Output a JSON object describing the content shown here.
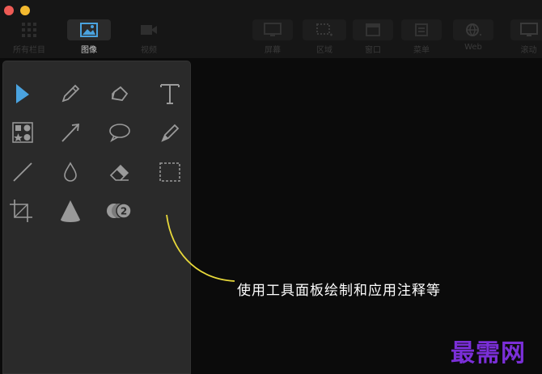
{
  "window": {
    "traffic_lights": [
      "close",
      "minimize"
    ]
  },
  "toolbar": {
    "items": [
      {
        "label": "所有栏目"
      },
      {
        "label": "图像"
      },
      {
        "label": "视频"
      },
      {
        "label": "屏幕"
      },
      {
        "label": "区域"
      },
      {
        "label": "窗口"
      },
      {
        "label": "菜单"
      },
      {
        "label": "Web"
      },
      {
        "label": "滚动"
      }
    ]
  },
  "tools_panel": {
    "tools": [
      {
        "icon": "arrow-cursor-icon"
      },
      {
        "icon": "pencil-icon"
      },
      {
        "icon": "highlighter-icon"
      },
      {
        "icon": "text-icon"
      },
      {
        "icon": "shapes-icon"
      },
      {
        "icon": "arrow-line-icon"
      },
      {
        "icon": "speech-bubble-icon"
      },
      {
        "icon": "marker-icon"
      },
      {
        "icon": "line-icon"
      },
      {
        "icon": "drop-icon"
      },
      {
        "icon": "eraser-icon"
      },
      {
        "icon": "selection-rect-icon"
      },
      {
        "icon": "crop-icon"
      },
      {
        "icon": "spotlight-icon"
      },
      {
        "icon": "counter-icon"
      }
    ],
    "counter_value": "2"
  },
  "annotation": {
    "text": "使用工具面板绘制和应用注释等",
    "line_color": "#e8d93a"
  },
  "watermark": {
    "text": "最需网"
  },
  "colors": {
    "accent": "#4aa3df",
    "tool_gray": "#9a9a9a",
    "watermark": "#7b2fd8"
  }
}
